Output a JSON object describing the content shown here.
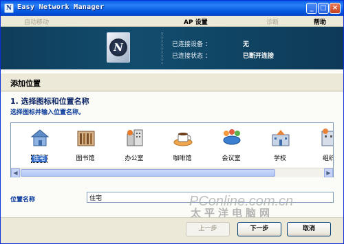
{
  "window": {
    "title": "Easy Network Manager"
  },
  "menubar": {
    "items": [
      {
        "label": "自动移动",
        "enabled": false
      },
      {
        "label": "AP 设置",
        "enabled": true
      },
      {
        "label": "诊断",
        "enabled": false
      },
      {
        "label": "帮助",
        "enabled": true
      }
    ]
  },
  "banner": {
    "logo_letter": "N",
    "connected_device_label": "已连接设备 ：",
    "connected_device_value": "无",
    "connection_status_label": "已连接状态 ：",
    "connection_status_value": "已断开连接"
  },
  "section": {
    "title": "添加位置",
    "step_title": "1. 选择图标和位置名称",
    "step_subtitle": "选择图标并输入位置名称。"
  },
  "locations": {
    "selected": "住宅",
    "items": [
      {
        "label": "住宅",
        "icon": "house-icon"
      },
      {
        "label": "图书馆",
        "icon": "library-icon"
      },
      {
        "label": "办公室",
        "icon": "office-icon"
      },
      {
        "label": "咖啡馆",
        "icon": "coffee-icon"
      },
      {
        "label": "会议室",
        "icon": "meeting-room-icon"
      },
      {
        "label": "学校",
        "icon": "school-icon"
      },
      {
        "label": "组织",
        "icon": "organization-icon"
      }
    ]
  },
  "name_field": {
    "label": "位置名称",
    "value": "住宅"
  },
  "buttons": {
    "prev": "上一步",
    "next": "下一步",
    "cancel": "取消"
  },
  "watermark": {
    "line1": "PConline.com.cn",
    "line2": "太平洋电脑网"
  },
  "colors": {
    "titlebar": "#0a5ee8",
    "banner": "#124d6e",
    "selection": "#316ac5"
  }
}
